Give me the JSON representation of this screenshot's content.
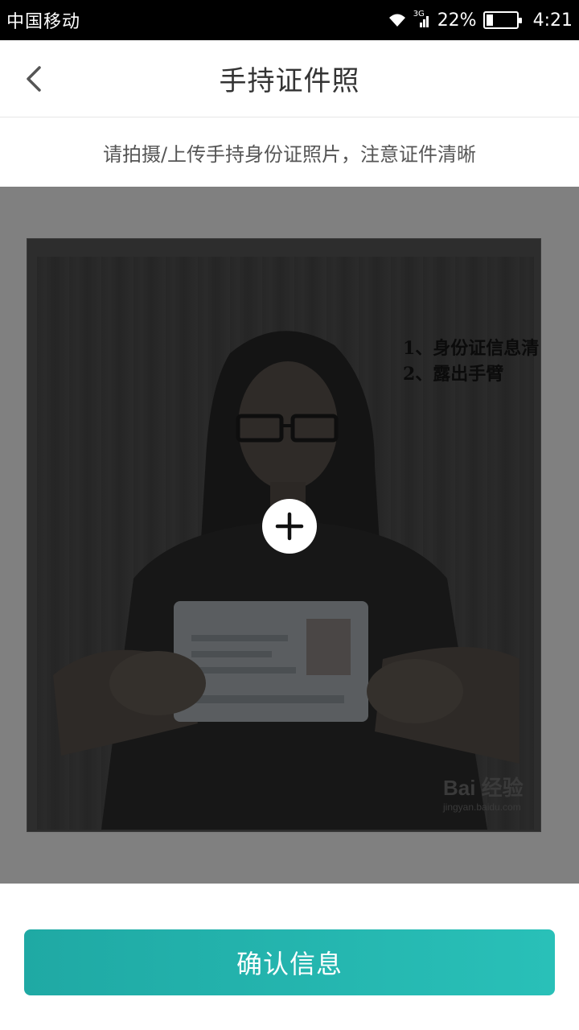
{
  "status_bar": {
    "carrier": "中国移动",
    "network": "3G",
    "battery": "22%",
    "time": "4:21"
  },
  "header": {
    "back_icon": "chevron-left-icon",
    "title": "手持证件照"
  },
  "instruction": "请拍摄/上传手持身份证照片，注意证件清晰",
  "sample_photo": {
    "note_line_1": "1、身份证信息清",
    "note_line_2": "2、露出手臂",
    "watermark_logo": "Bai 经验",
    "watermark_url": "jingyan.baidu.com"
  },
  "add_photo_icon": "plus-icon",
  "confirm_button": {
    "label": "确认信息",
    "color": "#26b8b1"
  }
}
